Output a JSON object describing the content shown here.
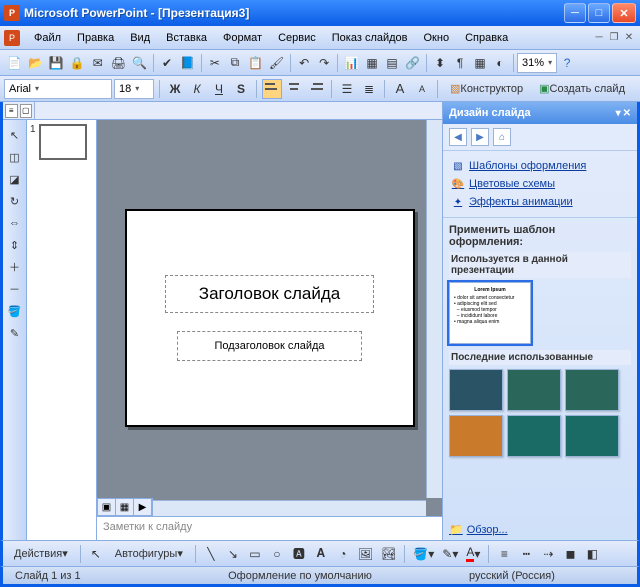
{
  "window": {
    "title": "Microsoft PowerPoint - [Презентация3]"
  },
  "menu": {
    "file": "Файл",
    "edit": "Правка",
    "view": "Вид",
    "insert": "Вставка",
    "format": "Формат",
    "service": "Сервис",
    "slideshow": "Показ слайдов",
    "window": "Окно",
    "help": "Справка"
  },
  "toolbar": {
    "zoom": "31%"
  },
  "format_bar": {
    "font": "Arial",
    "size": "18",
    "bold": "Ж",
    "italic": "К",
    "underline": "Ч",
    "shadow": "S",
    "designer": "Конструктор",
    "new_slide": "Создать слайд"
  },
  "thumbs": {
    "n1": "1"
  },
  "slide": {
    "title": "Заголовок слайда",
    "subtitle": "Подзаголовок слайда"
  },
  "notes": {
    "placeholder": "Заметки к слайду"
  },
  "taskpane": {
    "title": "Дизайн слайда",
    "link_templates": "Шаблоны оформления",
    "link_colors": "Цветовые схемы",
    "link_anim": "Эффекты анимации",
    "apply_header": "Применить шаблон оформления:",
    "used_header": "Используется в данной презентации",
    "recent_header": "Последние использованные",
    "browse": "Обзор..."
  },
  "draw": {
    "actions": "Действия",
    "autoshapes": "Автофигуры"
  },
  "status": {
    "slide_of": "Слайд 1 из 1",
    "design": "Оформление по умолчанию",
    "lang": "русский (Россия)"
  }
}
